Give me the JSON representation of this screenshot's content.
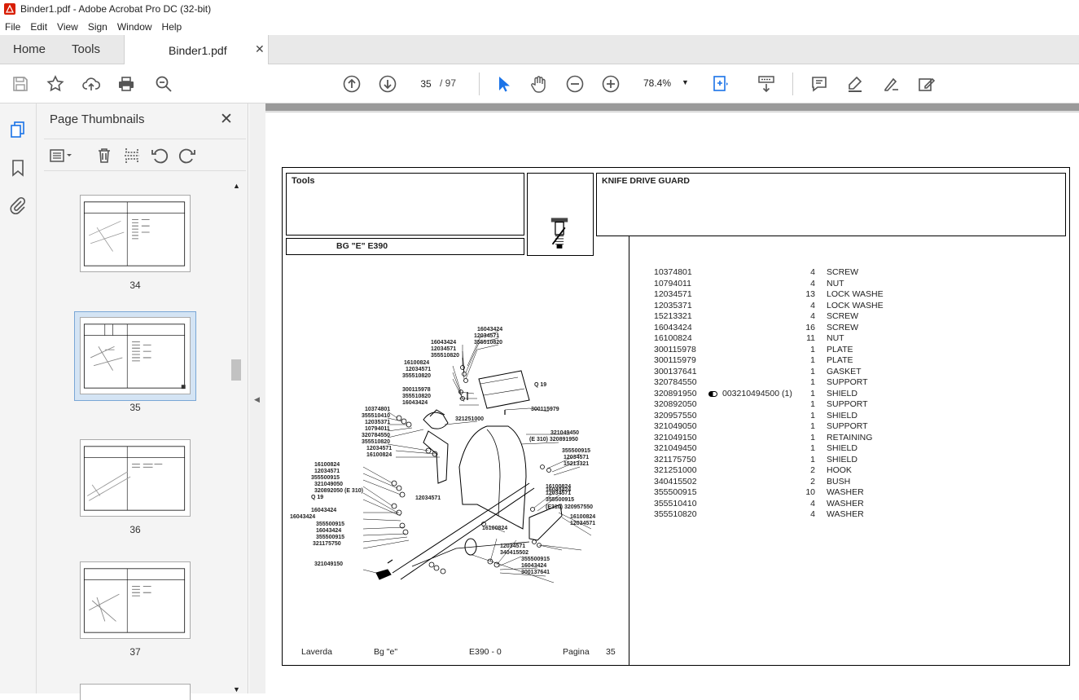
{
  "window": {
    "title": "Binder1.pdf - Adobe Acrobat Pro DC (32-bit)"
  },
  "menu": [
    "File",
    "Edit",
    "View",
    "Sign",
    "Window",
    "Help"
  ],
  "tabs": {
    "home": "Home",
    "tools": "Tools",
    "document": "Binder1.pdf"
  },
  "toolbar": {
    "page_current": "35",
    "page_total": "/ 97",
    "zoom": "78.4%"
  },
  "panel": {
    "title": "Page Thumbnails",
    "thumbnails": [
      {
        "label": "34"
      },
      {
        "label": "35",
        "selected": true
      },
      {
        "label": "36"
      },
      {
        "label": "37"
      }
    ]
  },
  "document": {
    "header_left": "Tools",
    "model_line": "BG \"E\"  E390",
    "header_right": "KNIFE DRIVE GUARD",
    "footer": {
      "maker": "Laverda",
      "series": "Bg \"e\"",
      "model": "E390 - 0",
      "page_word": "Pagina",
      "page_no": "35"
    },
    "parts": [
      {
        "code": "10374801",
        "qty": "4",
        "desc": "SCREW"
      },
      {
        "code": "10794011",
        "qty": "4",
        "desc": "NUT"
      },
      {
        "code": "12034571",
        "qty": "13",
        "desc": "LOCK WASHE"
      },
      {
        "code": "12035371",
        "qty": "4",
        "desc": "LOCK WASHE"
      },
      {
        "code": "15213321",
        "qty": "4",
        "desc": "SCREW"
      },
      {
        "code": "16043424",
        "qty": "16",
        "desc": "SCREW"
      },
      {
        "code": "16100824",
        "qty": "11",
        "desc": "NUT"
      },
      {
        "code": "300115978",
        "qty": "1",
        "desc": "PLATE"
      },
      {
        "code": "300115979",
        "qty": "1",
        "desc": "PLATE"
      },
      {
        "code": "300137641",
        "qty": "1",
        "desc": "GASKET"
      },
      {
        "code": "320784550",
        "qty": "1",
        "desc": "SUPPORT"
      },
      {
        "code": "320891950",
        "qty": "1",
        "desc": "SHIELD",
        "extra": "003210494500  (1)"
      },
      {
        "code": "320892050",
        "qty": "1",
        "desc": "SUPPORT"
      },
      {
        "code": "320957550",
        "qty": "1",
        "desc": "SHIELD"
      },
      {
        "code": "321049050",
        "qty": "1",
        "desc": "SUPPORT"
      },
      {
        "code": "321049150",
        "qty": "1",
        "desc": "RETAINING"
      },
      {
        "code": "321049450",
        "qty": "1",
        "desc": "SHIELD"
      },
      {
        "code": "321175750",
        "qty": "1",
        "desc": "SHIELD"
      },
      {
        "code": "321251000",
        "qty": "2",
        "desc": "HOOK"
      },
      {
        "code": "340415502",
        "qty": "2",
        "desc": "BUSH"
      },
      {
        "code": "355500915",
        "qty": "10",
        "desc": "WASHER"
      },
      {
        "code": "355510410",
        "qty": "4",
        "desc": "WASHER"
      },
      {
        "code": "355510820",
        "qty": "4",
        "desc": "WASHER"
      }
    ],
    "callouts": [
      "16043424",
      "12034571",
      "355510820",
      "16043424",
      "12034571",
      "355510820",
      "16100824",
      "12034571",
      "355510820",
      "300115978",
      "355510820",
      "16043424",
      "10374801",
      "355510410",
      "12035371",
      "10794011",
      "320784550",
      "355510820",
      "12034571",
      "16100824",
      "321251000",
      "300115979",
      "Q 19",
      "321049450",
      "(E 310) 320891950",
      "355500915",
      "12034571",
      "15213321",
      "16100824",
      "12034571",
      "355500915",
      "16043424",
      "16100824",
      "12034571",
      "355500915",
      "321049050",
      "320892050 (E 310)",
      "Q 19",
      "16043424",
      "16043424",
      "12034571",
      "355500915",
      "16043424",
      "355500915",
      "321175750",
      "(E310) 320957550",
      "16100824",
      "12034571",
      "16100824",
      "12034571",
      "340415502",
      "355500915",
      "16043424",
      "300137641",
      "321049150"
    ]
  }
}
